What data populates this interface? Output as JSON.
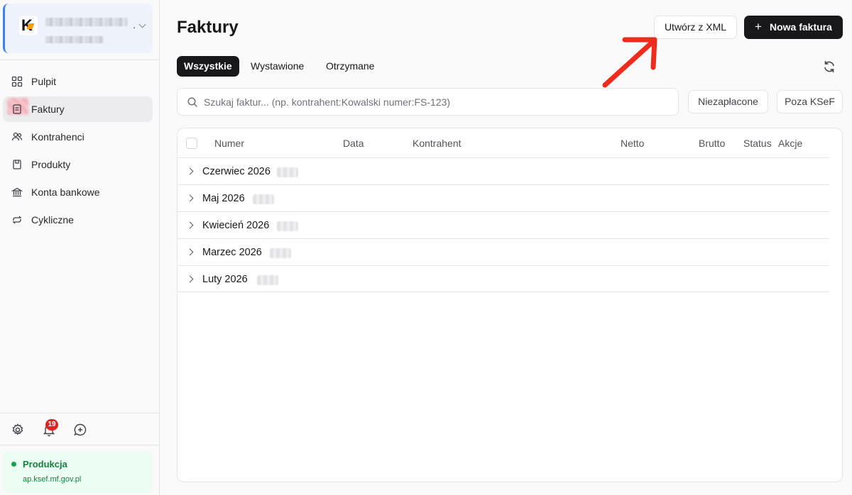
{
  "sidebar": {
    "nav": [
      {
        "label": "Pulpit",
        "icon": "grid-icon"
      },
      {
        "label": "Faktury",
        "icon": "invoice-icon",
        "active": true
      },
      {
        "label": "Kontrahenci",
        "icon": "users-icon"
      },
      {
        "label": "Produkty",
        "icon": "box-icon"
      },
      {
        "label": "Konta bankowe",
        "icon": "bank-icon"
      },
      {
        "label": "Cykliczne",
        "icon": "repeat-icon"
      }
    ],
    "notifications_count": "19",
    "environment": {
      "name": "Produkcja",
      "url": "ap.ksef.mf.gov.pl",
      "color": "#16a34a"
    }
  },
  "main": {
    "title": "Faktury",
    "buttons": {
      "create_from_xml": "Utwórz z XML",
      "new_invoice": "Nowa faktura"
    },
    "tabs": [
      "Wszystkie",
      "Wystawione",
      "Otrzymane"
    ],
    "active_tab": "Wszystkie",
    "search": {
      "placeholder": "Szukaj faktur... (np. kontrahent:Kowalski numer:FS-123)"
    },
    "filters": [
      "Niezapłacone",
      "Poza KSeF"
    ],
    "table": {
      "columns": [
        "Numer",
        "Data",
        "Kontrahent",
        "Netto",
        "Brutto",
        "Status",
        "Akcje"
      ],
      "groups": [
        "Czerwiec 2026",
        "Maj 2026",
        "Kwiecień 2026",
        "Marzec 2026",
        "Luty 2026"
      ]
    }
  },
  "colors": {
    "accent": "#18181b",
    "arrow": "#ef2b1d",
    "badge": "#dc2626"
  }
}
